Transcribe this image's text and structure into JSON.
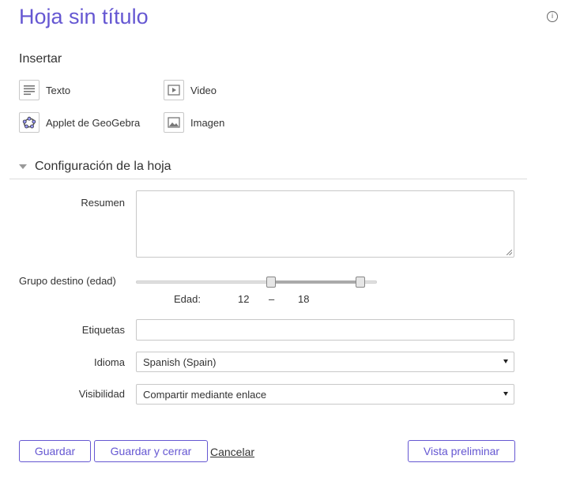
{
  "page": {
    "title": "Hoja sin título",
    "info_icon": "info-icon"
  },
  "insert": {
    "heading": "Insertar",
    "items": [
      {
        "label": "Texto",
        "icon": "text-icon"
      },
      {
        "label": "Video",
        "icon": "video-icon"
      },
      {
        "label": "Applet de GeoGebra",
        "icon": "geogebra-icon"
      },
      {
        "label": "Imagen",
        "icon": "image-icon"
      }
    ]
  },
  "config": {
    "heading": "Configuración de la hoja",
    "summary": {
      "label": "Resumen",
      "value": ""
    },
    "age_group": {
      "label": "Grupo destino (edad)",
      "age_label": "Edad:",
      "min": 12,
      "dash": "–",
      "max": 18,
      "min_fraction": 0.56,
      "max_fraction": 0.93
    },
    "tags": {
      "label": "Etiquetas",
      "value": ""
    },
    "language": {
      "label": "Idioma",
      "value": "Spanish (Spain)"
    },
    "visibility": {
      "label": "Visibilidad",
      "value": "Compartir mediante enlace"
    }
  },
  "actions": {
    "save": "Guardar",
    "save_close": "Guardar y cerrar",
    "cancel": "Cancelar",
    "preview": "Vista preliminar"
  },
  "colors": {
    "accent": "#6557d2",
    "border": "#c8c8c8"
  }
}
